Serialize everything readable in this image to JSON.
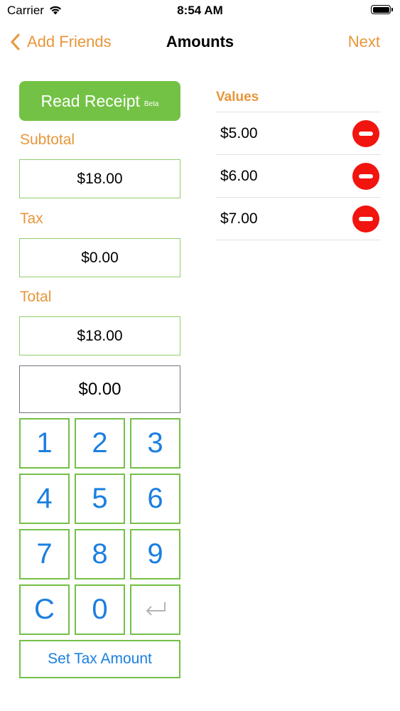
{
  "status": {
    "carrier": "Carrier",
    "time": "8:54 AM"
  },
  "nav": {
    "back_label": "Add Friends",
    "title": "Amounts",
    "next_label": "Next"
  },
  "receipt": {
    "label": "Read Receipt",
    "badge": "Beta"
  },
  "fields": {
    "subtotal_label": "Subtotal",
    "subtotal_value": "$18.00",
    "tax_label": "Tax",
    "tax_value": "$0.00",
    "total_label": "Total",
    "total_value": "$18.00"
  },
  "entry": {
    "value": "$0.00"
  },
  "keypad": {
    "keys": [
      "1",
      "2",
      "3",
      "4",
      "5",
      "6",
      "7",
      "8",
      "9",
      "C",
      "0"
    ],
    "enter_icon": "return-icon",
    "action_label": "Set Tax Amount"
  },
  "values": {
    "header": "Values",
    "items": [
      {
        "amount": "$5.00"
      },
      {
        "amount": "$6.00"
      },
      {
        "amount": "$7.00"
      }
    ],
    "remove_icon": "minus-circle-icon"
  },
  "colors": {
    "accent": "#e8963a",
    "green": "#73c245",
    "key_text": "#1a7fe0",
    "delete": "#f2140f"
  }
}
